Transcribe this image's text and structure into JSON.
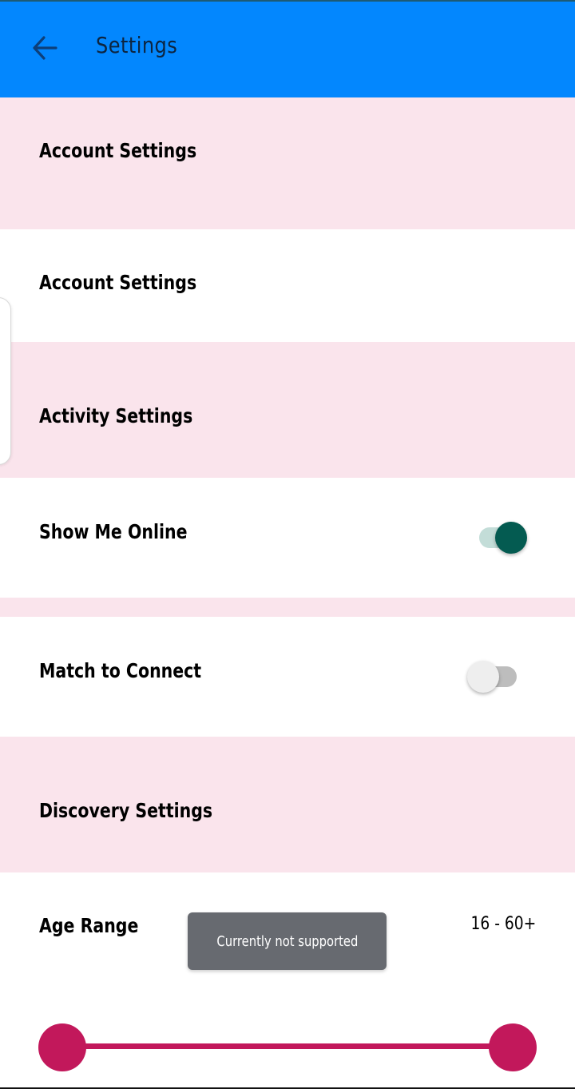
{
  "appbar": {
    "title": "Settings",
    "back_icon": "arrow-left-icon",
    "color": "#0387fe"
  },
  "sections": {
    "account_header": "Account Settings",
    "account_item": "Account Settings",
    "activity_header": "Activity Settings",
    "show_me_online": {
      "label": "Show Me Online",
      "on": true
    },
    "match_to_connect": {
      "label": "Match to Connect",
      "on": false
    },
    "discovery_header": "Discovery Settings",
    "age_range": {
      "label": "Age Range",
      "value": "16 - 60+"
    }
  },
  "toast": {
    "message": "Currently not supported"
  },
  "colors": {
    "section_pink": "#fae4ec",
    "switch_on": "#045b51",
    "slider": "#c2185b"
  }
}
